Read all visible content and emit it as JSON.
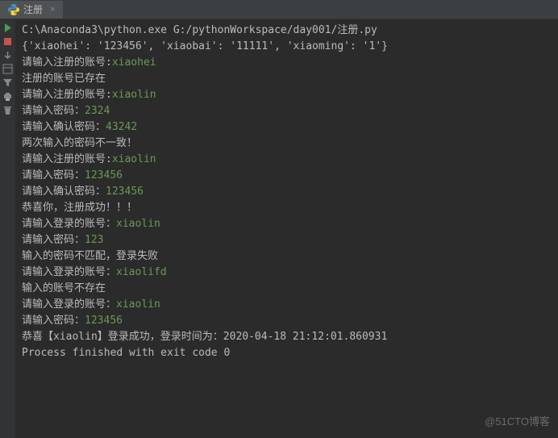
{
  "tab": {
    "label": "注册",
    "close": "×"
  },
  "console": {
    "lines": [
      {
        "segments": [
          {
            "cls": "cmd",
            "text": "C:\\Anaconda3\\python.exe G:/pythonWorkspace/day001/注册.py"
          }
        ]
      },
      {
        "segments": [
          {
            "cls": "cmd",
            "text": "{'xiaohei': '123456', 'xiaobai': '11111', 'xiaoming': '1'}"
          }
        ]
      },
      {
        "segments": [
          {
            "cls": "prompt",
            "text": "请输入注册的账号:"
          },
          {
            "cls": "input-green",
            "text": "xiaohei"
          }
        ]
      },
      {
        "segments": [
          {
            "cls": "prompt",
            "text": "注册的账号已存在"
          }
        ]
      },
      {
        "segments": [
          {
            "cls": "prompt",
            "text": "请输入注册的账号:"
          },
          {
            "cls": "input-green",
            "text": "xiaolin"
          }
        ]
      },
      {
        "segments": [
          {
            "cls": "prompt",
            "text": "请输入密码："
          },
          {
            "cls": "input-green",
            "text": "2324"
          }
        ]
      },
      {
        "segments": [
          {
            "cls": "prompt",
            "text": "请输入确认密码："
          },
          {
            "cls": "input-green",
            "text": "43242"
          }
        ]
      },
      {
        "segments": [
          {
            "cls": "prompt",
            "text": "两次输入的密码不一致！"
          }
        ]
      },
      {
        "segments": [
          {
            "cls": "prompt",
            "text": "请输入注册的账号:"
          },
          {
            "cls": "input-green",
            "text": "xiaolin"
          }
        ]
      },
      {
        "segments": [
          {
            "cls": "prompt",
            "text": "请输入密码："
          },
          {
            "cls": "input-green",
            "text": "123456"
          }
        ]
      },
      {
        "segments": [
          {
            "cls": "prompt",
            "text": "请输入确认密码："
          },
          {
            "cls": "input-green",
            "text": "123456"
          }
        ]
      },
      {
        "segments": [
          {
            "cls": "prompt",
            "text": "恭喜你，注册成功！！！"
          }
        ]
      },
      {
        "segments": [
          {
            "cls": "prompt",
            "text": "请输入登录的账号："
          },
          {
            "cls": "input-green",
            "text": "xiaolin"
          }
        ]
      },
      {
        "segments": [
          {
            "cls": "prompt",
            "text": "请输入密码："
          },
          {
            "cls": "input-green",
            "text": "123"
          }
        ]
      },
      {
        "segments": [
          {
            "cls": "prompt",
            "text": "输入的密码不匹配，登录失败"
          }
        ]
      },
      {
        "segments": [
          {
            "cls": "prompt",
            "text": "请输入登录的账号："
          },
          {
            "cls": "input-green",
            "text": "xiaolifd"
          }
        ]
      },
      {
        "segments": [
          {
            "cls": "prompt",
            "text": "输入的账号不存在"
          }
        ]
      },
      {
        "segments": [
          {
            "cls": "prompt",
            "text": "请输入登录的账号："
          },
          {
            "cls": "input-green",
            "text": "xiaolin"
          }
        ]
      },
      {
        "segments": [
          {
            "cls": "prompt",
            "text": "请输入密码："
          },
          {
            "cls": "input-green",
            "text": "123456"
          }
        ]
      },
      {
        "segments": [
          {
            "cls": "prompt",
            "text": "恭喜【xiaolin】登录成功，登录时间为：2020-04-18 21:12:01.860931"
          }
        ]
      },
      {
        "segments": [
          {
            "cls": "prompt",
            "text": ""
          }
        ]
      },
      {
        "segments": [
          {
            "cls": "prompt",
            "text": "Process finished with exit code 0"
          }
        ]
      }
    ]
  },
  "watermark": "@51CTO博客"
}
